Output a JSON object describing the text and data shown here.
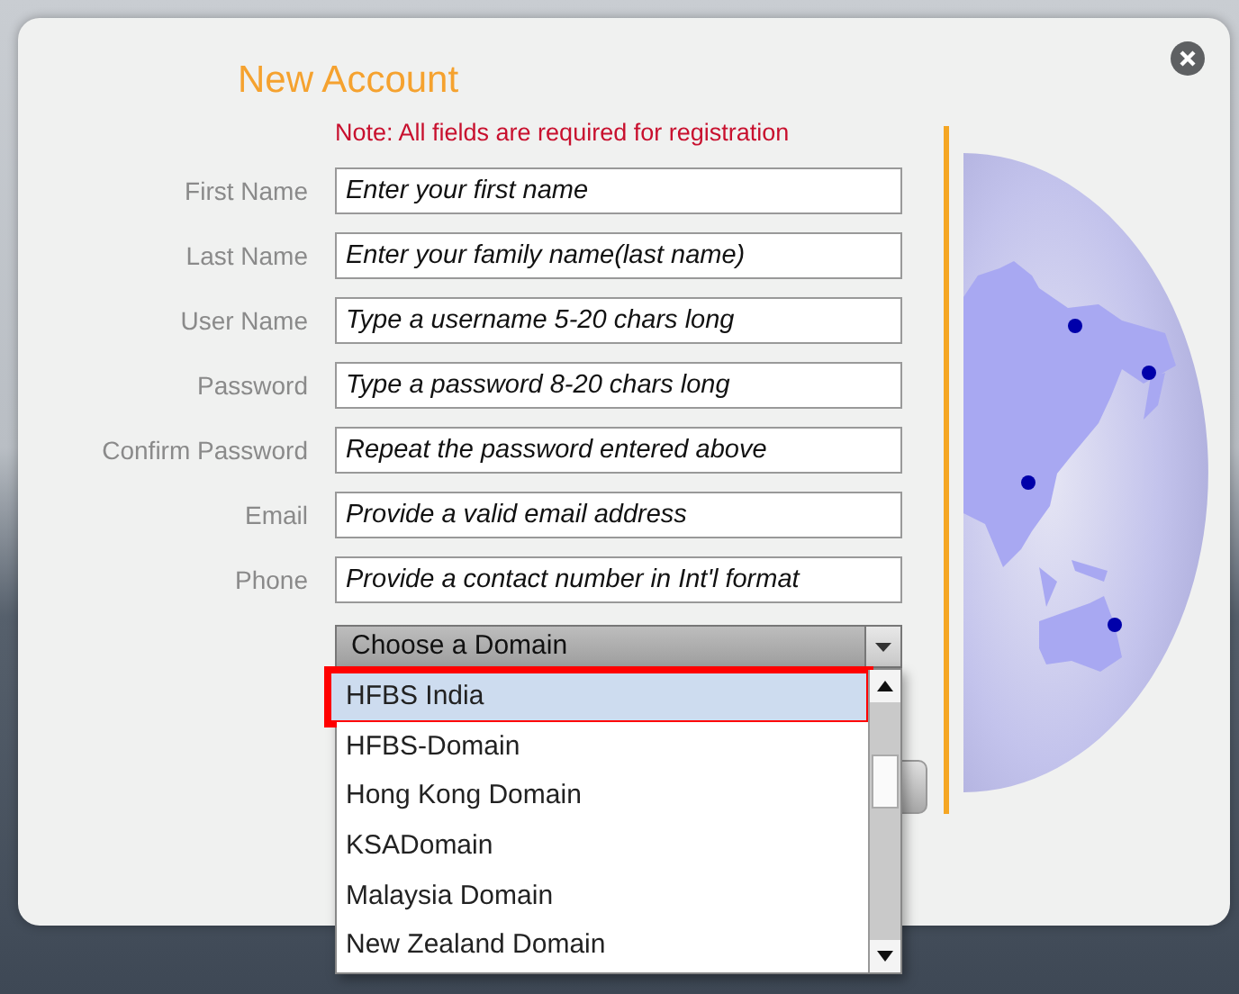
{
  "dialog": {
    "title": "New Account",
    "note": "Note: All fields are required for registration"
  },
  "fields": [
    {
      "label": "First Name",
      "placeholder": "Enter your first name"
    },
    {
      "label": "Last Name",
      "placeholder": "Enter your family name(last name)"
    },
    {
      "label": "User Name",
      "placeholder": "Type a username 5-20 chars long"
    },
    {
      "label": "Password",
      "placeholder": "Type a password 8-20 chars long"
    },
    {
      "label": "Confirm Password",
      "placeholder": "Repeat the password entered above"
    },
    {
      "label": "Email",
      "placeholder": "Provide a valid email address"
    },
    {
      "label": "Phone",
      "placeholder": "Provide a contact number in Int'l format"
    }
  ],
  "domain_select": {
    "value": "Choose a Domain",
    "expanded": true,
    "options": [
      {
        "label": "HFBS India",
        "selected": true
      },
      {
        "label": "HFBS-Domain",
        "selected": false
      },
      {
        "label": "Hong Kong Domain",
        "selected": false
      },
      {
        "label": "KSADomain",
        "selected": false
      },
      {
        "label": "Malaysia Domain",
        "selected": false
      },
      {
        "label": "New Zealand Domain",
        "selected": false
      }
    ]
  }
}
